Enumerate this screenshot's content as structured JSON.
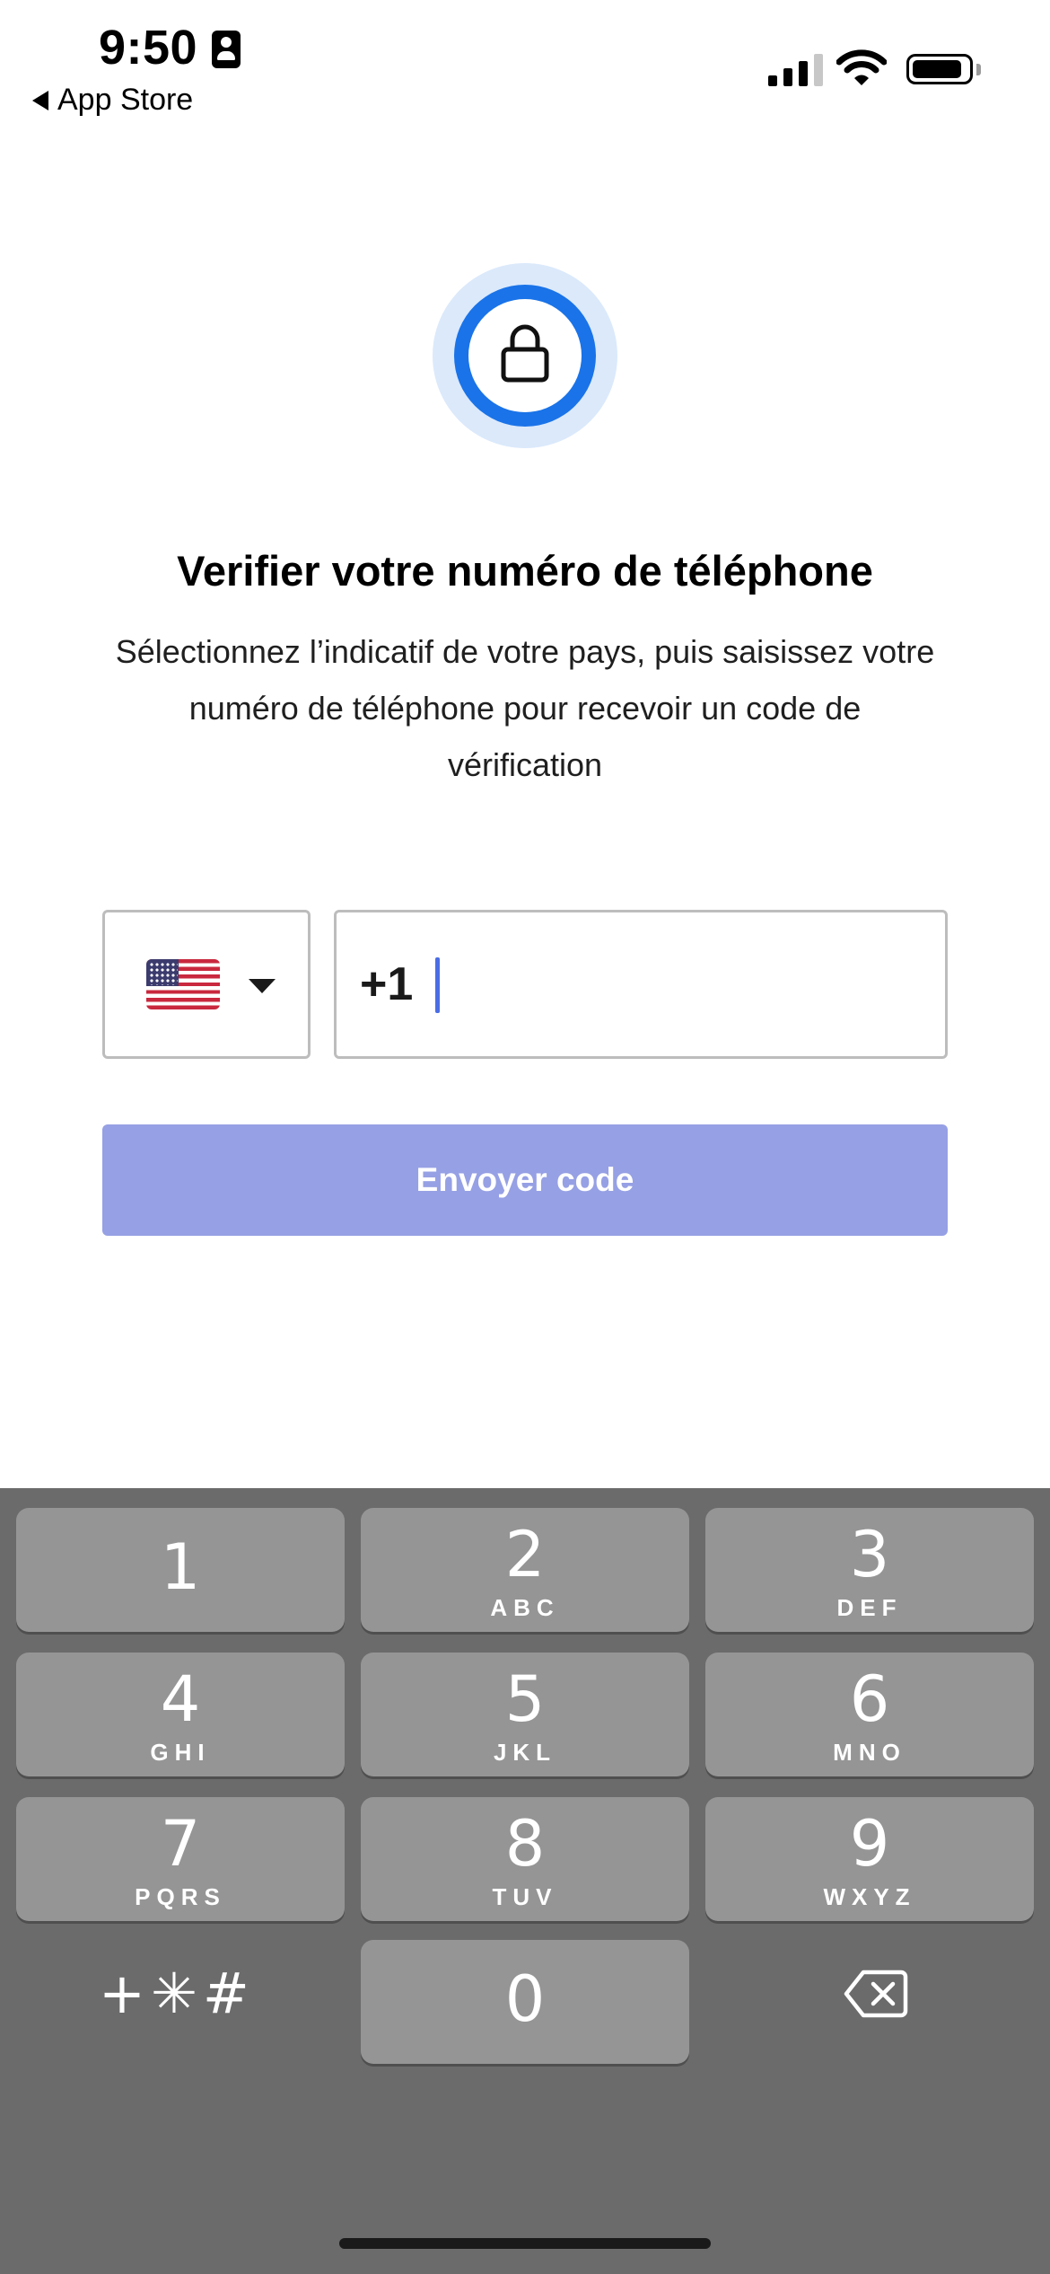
{
  "status_bar": {
    "time": "9:50",
    "back_label": "App Store"
  },
  "header": {
    "title": "Verifier votre numéro de téléphone",
    "subtitle": "Sélectionnez l’indicatif de votre pays, puis saisissez votre numéro de téléphone pour recevoir un code de vérification"
  },
  "form": {
    "country_icon": "us-flag-icon",
    "dial_code": "+1",
    "phone_value": "",
    "send_label": "Envoyer code"
  },
  "colors": {
    "accent": "#1a73e8",
    "button": "#96a0e4",
    "keyboard": "#6b6b6b",
    "key": "#959595"
  },
  "keypad": {
    "k1": {
      "digit": "1",
      "letters": ""
    },
    "k2": {
      "digit": "2",
      "letters": "ABC"
    },
    "k3": {
      "digit": "3",
      "letters": "DEF"
    },
    "k4": {
      "digit": "4",
      "letters": "GHI"
    },
    "k5": {
      "digit": "5",
      "letters": "JKL"
    },
    "k6": {
      "digit": "6",
      "letters": "MNO"
    },
    "k7": {
      "digit": "7",
      "letters": "PQRS"
    },
    "k8": {
      "digit": "8",
      "letters": "TUV"
    },
    "k9": {
      "digit": "9",
      "letters": "WXYZ"
    },
    "k0": {
      "digit": "0",
      "letters": ""
    },
    "symbols": "+✳#"
  }
}
